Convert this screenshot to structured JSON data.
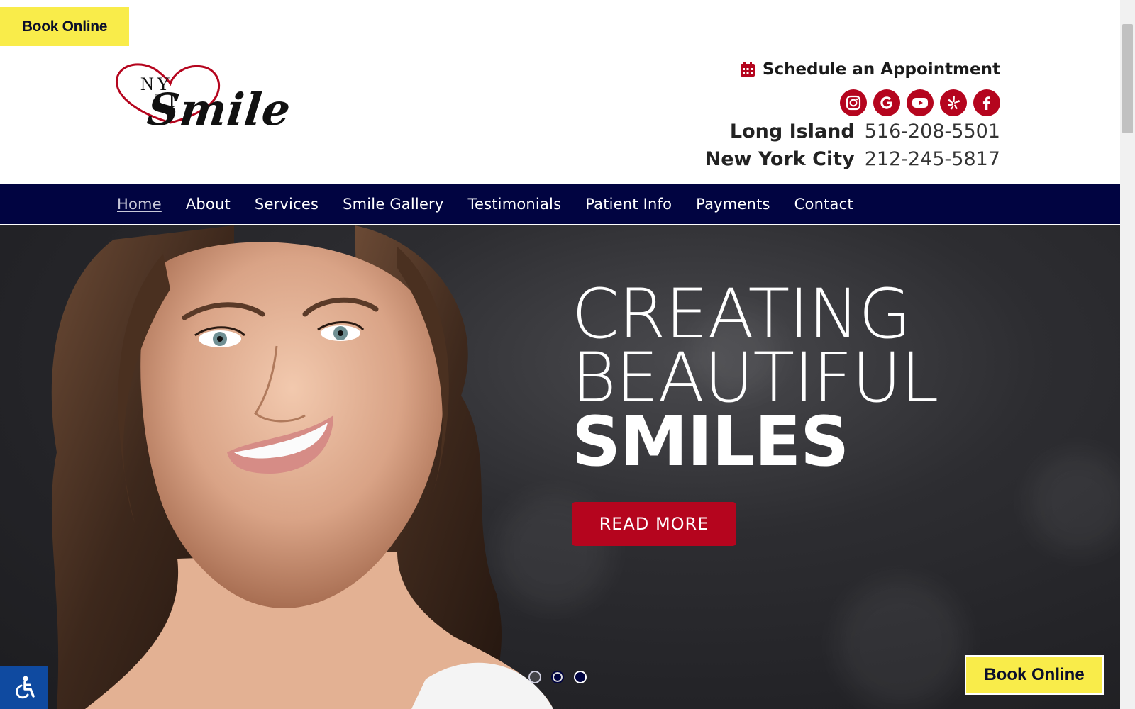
{
  "top_bar": {
    "book_online_label": "Book Online"
  },
  "logo": {
    "ny": "NY",
    "li": "LI",
    "smile": "Smile",
    "colors": {
      "heart": "#b5051e",
      "text": "#111111"
    }
  },
  "header": {
    "schedule_label": "Schedule an Appointment",
    "social_icons": [
      "instagram-icon",
      "google-icon",
      "youtube-icon",
      "yelp-icon",
      "facebook-icon"
    ],
    "locations": [
      {
        "name": "Long Island",
        "phone": "516-208-5501"
      },
      {
        "name": "New York City",
        "phone": "212-245-5817"
      }
    ]
  },
  "nav": {
    "items": [
      {
        "label": "Home",
        "active": true
      },
      {
        "label": "About"
      },
      {
        "label": "Services"
      },
      {
        "label": "Smile Gallery"
      },
      {
        "label": "Testimonials"
      },
      {
        "label": "Patient Info"
      },
      {
        "label": "Payments"
      },
      {
        "label": "Contact"
      }
    ]
  },
  "hero": {
    "line1": "CREATING",
    "line2": "BEAUTIFUL",
    "line3": "SMILES",
    "cta_label": "READ MORE",
    "slide_count": 3
  },
  "floating": {
    "book_online_label": "Book Online",
    "accessibility_icon": "wheelchair-icon"
  },
  "colors": {
    "brand_red": "#b5051e",
    "nav_navy": "#010441",
    "book_yellow": "#f9ec4a",
    "accessibility_blue": "#0f4aa0"
  }
}
